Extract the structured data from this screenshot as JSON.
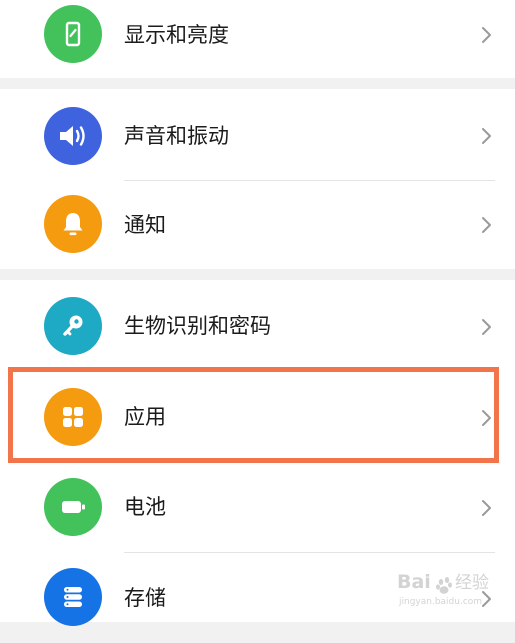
{
  "settings": {
    "items": [
      {
        "label": "显示和亮度",
        "icon": "display-phone-icon",
        "color": "#43c25b"
      },
      {
        "label": "声音和振动",
        "icon": "speaker-volume-icon",
        "color": "#3f63df"
      },
      {
        "label": "通知",
        "icon": "bell-icon",
        "color": "#f59b10"
      },
      {
        "label": "生物识别和密码",
        "icon": "key-icon",
        "color": "#1ea9c4"
      },
      {
        "label": "应用",
        "icon": "apps-grid-icon",
        "color": "#f59b10"
      },
      {
        "label": "电池",
        "icon": "battery-icon",
        "color": "#43c25b"
      },
      {
        "label": "存储",
        "icon": "storage-database-icon",
        "color": "#1673e5"
      }
    ],
    "highlighted_item": "应用",
    "highlight_color": "#f2744a"
  },
  "watermark": {
    "text": "Baidu 经验",
    "subtext": "jingyan.baidu.com"
  }
}
